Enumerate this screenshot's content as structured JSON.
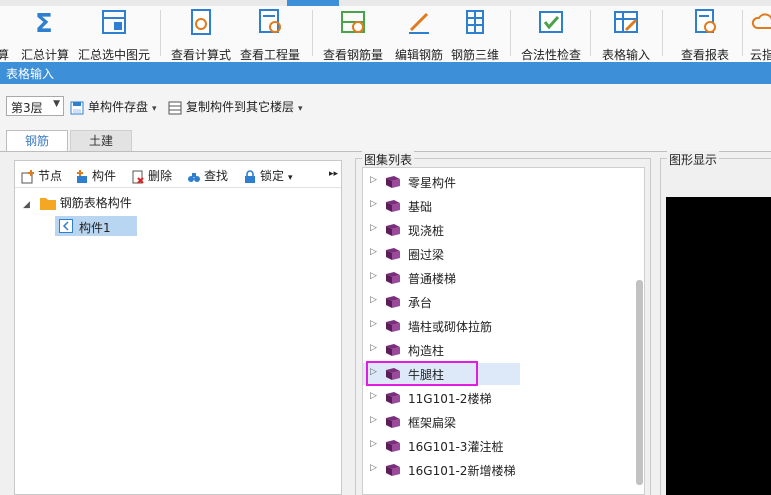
{
  "ribbon": {
    "items": [
      {
        "label": "算"
      },
      {
        "label": "汇总计算"
      },
      {
        "label": "汇总选中图元"
      },
      {
        "label": "查看计算式"
      },
      {
        "label": "查看工程量"
      },
      {
        "label": "查看钢筋量"
      },
      {
        "label": "编辑钢筋"
      },
      {
        "label": "钢筋三维"
      },
      {
        "label": "合法性检查"
      },
      {
        "label": "表格输入"
      },
      {
        "label": "查看报表"
      },
      {
        "label": "云指"
      }
    ]
  },
  "window": {
    "title": "表格输入"
  },
  "toolbar": {
    "floor": "第3层",
    "save_single": "单构件存盘",
    "copy_to_floor": "复制构件到其它楼层"
  },
  "tabs": [
    {
      "label": "钢筋"
    },
    {
      "label": "土建"
    }
  ],
  "left_panel": {
    "buttons": {
      "node": "节点",
      "component": "构件",
      "delete": "删除",
      "find": "查找",
      "lock": "锁定"
    },
    "tree": {
      "root": "钢筋表格构件",
      "child": "构件1"
    }
  },
  "atlas": {
    "legend": "图集列表",
    "items": [
      {
        "label": "零星构件"
      },
      {
        "label": "基础"
      },
      {
        "label": "现浇桩"
      },
      {
        "label": "圈过梁"
      },
      {
        "label": "普通楼梯"
      },
      {
        "label": "承台"
      },
      {
        "label": "墙柱或砌体拉筋"
      },
      {
        "label": "构造柱"
      },
      {
        "label": "牛腿柱"
      },
      {
        "label": "11G101-2楼梯"
      },
      {
        "label": "框架扁梁"
      },
      {
        "label": "16G101-3灌注桩"
      },
      {
        "label": "16G101-2新增楼梯"
      }
    ],
    "selected_label": "牛腿柱"
  },
  "display": {
    "legend": "图形显示"
  },
  "colors": {
    "accent": "#3d8fd8",
    "highlight": "#e01de0",
    "book": "#7a2f7a"
  }
}
